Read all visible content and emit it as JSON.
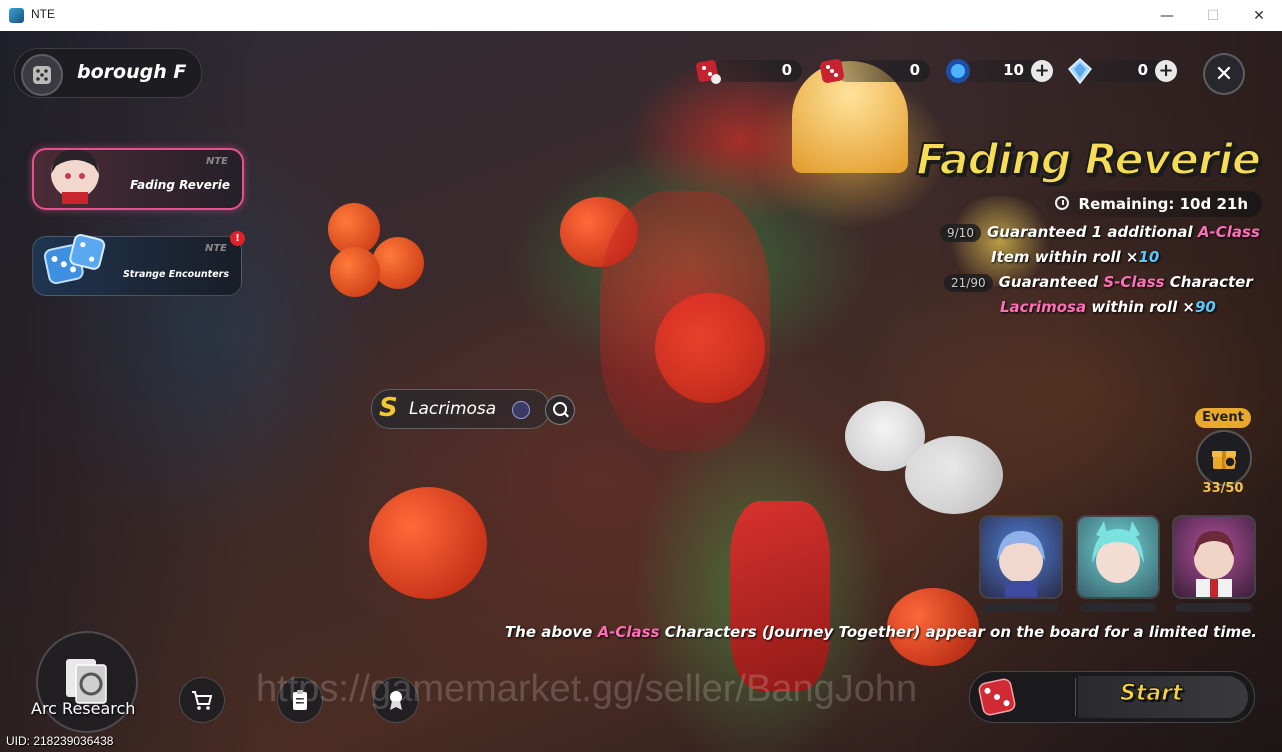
{
  "window": {
    "title": "NTE",
    "minimize": "—",
    "maximize": "☐",
    "close": "✕"
  },
  "location": {
    "label": "borough F"
  },
  "banners": [
    {
      "brand": "NTE",
      "name": "Fading Reverie",
      "active": true
    },
    {
      "brand": "NTE",
      "name": "Strange Encounters",
      "alert": "!"
    }
  ],
  "resources": [
    {
      "icon": "dice-ticket-icon",
      "value": "0"
    },
    {
      "icon": "red-dice-icon",
      "value": "0"
    },
    {
      "icon": "blue-crystal-icon",
      "value": "10"
    },
    {
      "icon": "light-crystal-icon",
      "value": "0"
    }
  ],
  "banner_info": {
    "title": "Fading Reverie",
    "remaining": "Remaining: 10d 21h",
    "guarantee_a": {
      "count": "9/10",
      "text1": "Guaranteed 1 additional ",
      "highlight": "A-Class",
      "text2": "Item within roll ×",
      "num": "10"
    },
    "guarantee_s": {
      "count": "21/90",
      "text1": "Guaranteed ",
      "highlight": "S-Class",
      "text2": " Character",
      "name": "Lacrimosa",
      "text3": " within roll ×",
      "num": "90"
    }
  },
  "featured": {
    "rank": "S",
    "name": "Lacrimosa"
  },
  "event": {
    "tag": "Event",
    "progress": "33/50"
  },
  "note": {
    "text1": "The above ",
    "highlight": "A-Class",
    "text2": " Characters (Journey Together) appear on the board for a limited time."
  },
  "start": {
    "label": "Start"
  },
  "bottom": {
    "arc_label": "Arc Research",
    "uid": "UID: 218239036438"
  },
  "watermark": "https://gamemarket.gg/seller/BangJohn",
  "colors": {
    "accent_pink": "#ff6fb7",
    "accent_blue": "#57c8ff",
    "title_yellow": "#f7dd55"
  }
}
